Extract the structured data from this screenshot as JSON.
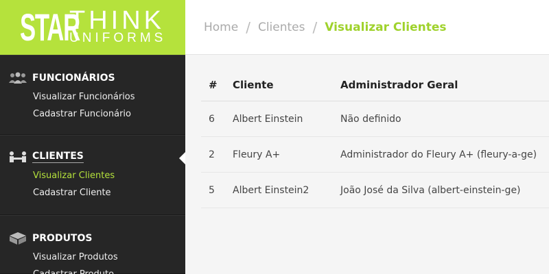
{
  "logo": {
    "star": "STAR",
    "think": "THINK",
    "uniforms": "UNIFORMS"
  },
  "sidebar": {
    "sections": [
      {
        "title": "FUNCIONÁRIOS",
        "icon": "users-icon",
        "links": [
          "Visualizar Funcionários",
          "Cadastrar Funcionário"
        ]
      },
      {
        "title": "CLIENTES",
        "icon": "handshake-icon",
        "links": [
          "Visualizar Clientes",
          "Cadastrar Cliente"
        ]
      },
      {
        "title": "PRODUTOS",
        "icon": "box-icon",
        "links": [
          "Visualizar Produtos",
          "Cadastrar Produto"
        ]
      }
    ]
  },
  "breadcrumb": {
    "home": "Home",
    "section": "Clientes",
    "current": "Visualizar Clientes",
    "separator": "/"
  },
  "table": {
    "headers": [
      "#",
      "Cliente",
      "Administrador Geral"
    ],
    "rows": [
      [
        "6",
        "Albert Einstein",
        "Não definido"
      ],
      [
        "2",
        "Fleury A+",
        "Administrador do Fleury A+ (fleury-a-ge)"
      ],
      [
        "5",
        "Albert Einstein2",
        "João José da Silva (albert-einstein-ge)"
      ]
    ]
  },
  "colors": {
    "accent": "#b5e23c",
    "sidebar_bg": "#262626",
    "active_link": "#b5e23c"
  }
}
